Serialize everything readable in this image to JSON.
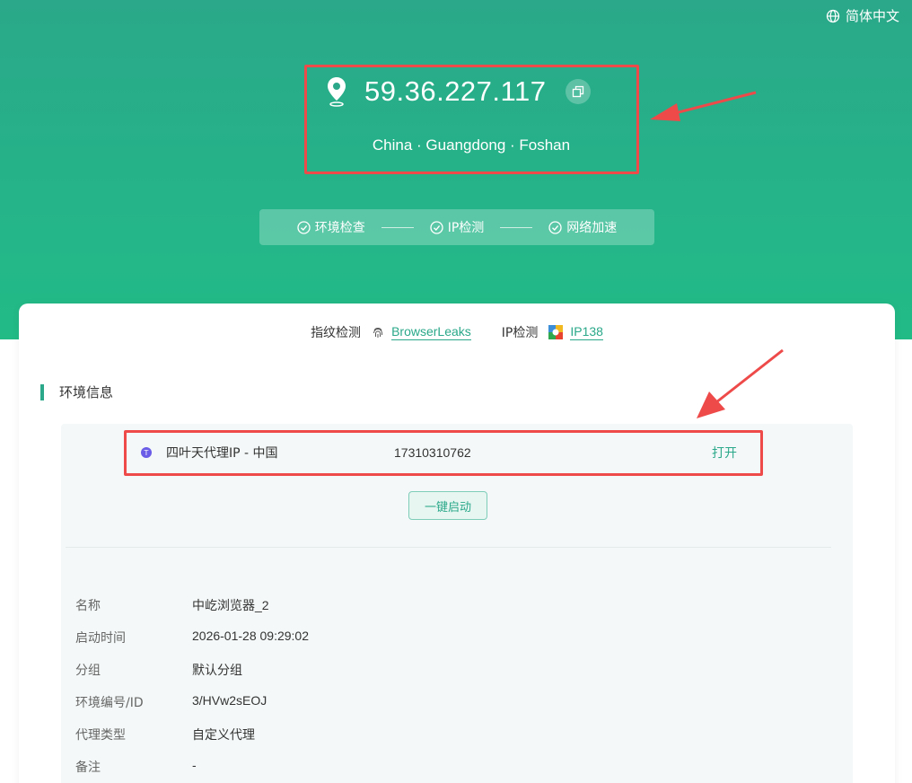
{
  "header": {
    "language": "简体中文",
    "ip": "59.36.227.117",
    "location": "China · Guangdong · Foshan",
    "steps": [
      "环境检查",
      "IP检测",
      "网络加速"
    ]
  },
  "detect": {
    "fingerprint_label": "指纹检测",
    "fingerprint_link": "BrowserLeaks",
    "ip_label": "IP检测",
    "ip_link": "IP138"
  },
  "section": {
    "title": "环境信息"
  },
  "proxy": {
    "name": "四叶天代理IP - 中国",
    "phone": "17310310762",
    "open_label": "打开"
  },
  "launch_label": "一键启动",
  "info": [
    {
      "key": "名称",
      "value": "中屹浏览器_2"
    },
    {
      "key": "启动时间",
      "value": "2026-01-28 09:29:02"
    },
    {
      "key": "分组",
      "value": "默认分组"
    },
    {
      "key": "环境编号/ID",
      "value": "3/HVw2sEOJ"
    },
    {
      "key": "代理类型",
      "value": "自定义代理"
    },
    {
      "key": "备注",
      "value": "-"
    }
  ],
  "colors": {
    "accent": "#2aa889",
    "annotation": "#ee4a4a"
  }
}
